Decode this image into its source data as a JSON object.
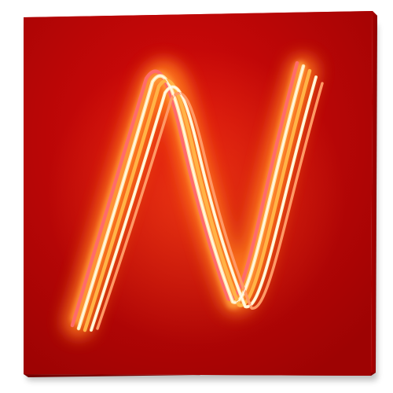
{
  "icon": {
    "name": "neon-n-app-icon",
    "glyph": "N",
    "colors": {
      "tile_front_center": "#d90a0a",
      "tile_front_edge": "#9e0303",
      "tile_top": "#d62b2b",
      "tile_side": "#a80000",
      "tile_bottom": "#7a0000",
      "neon_glow": "#ff7a1a",
      "neon_core": "#ffe8b0",
      "neon_pink": "#ff6b6b",
      "neon_orange": "#ffb347",
      "shadow": "#bdbdbd"
    }
  }
}
